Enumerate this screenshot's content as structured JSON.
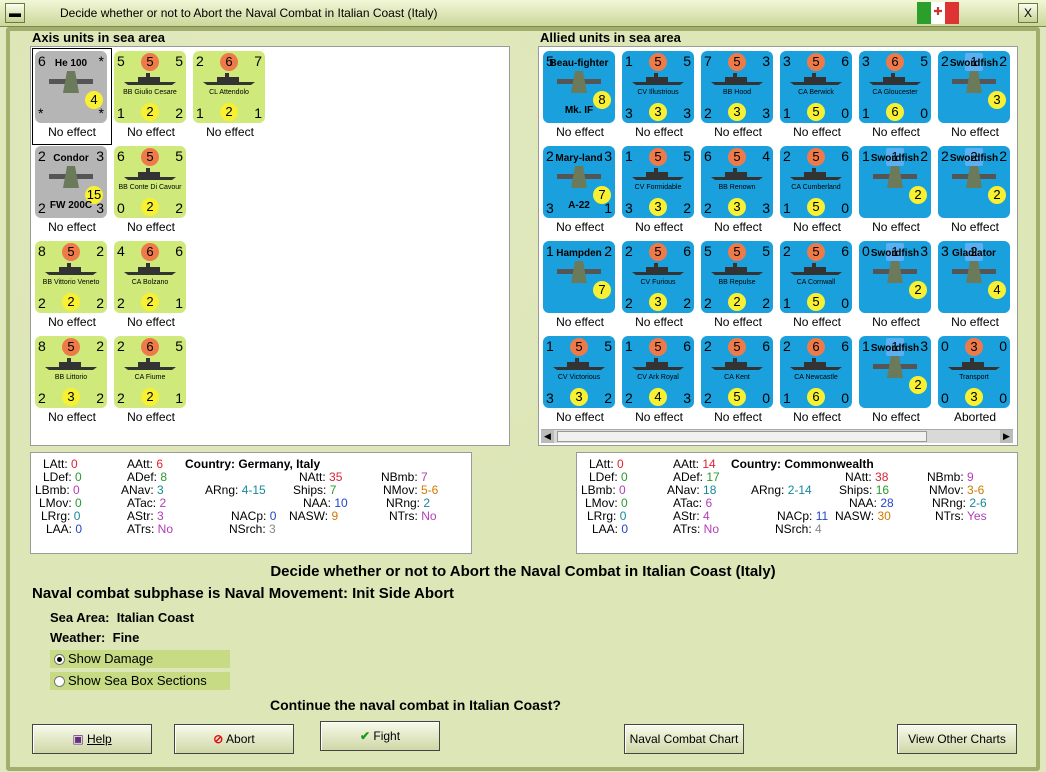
{
  "window": {
    "title": "Decide whether or not to Abort the Naval Combat in Italian Coast (Italy)",
    "min_icon": "minimize-icon",
    "close_label": "X"
  },
  "axis": {
    "header": "Axis units in sea area",
    "units": [
      {
        "name": "He 100",
        "tl": "6",
        "tr": "*",
        "bl": "*",
        "br": "*",
        "mid": "4",
        "status": "No effect",
        "color": "grey",
        "kind": "plane"
      },
      {
        "name": "BB Giulio Cesare",
        "tl": "5",
        "tr": "5",
        "bl": "1",
        "br": "2",
        "mid": "2",
        "top": "5",
        "status": "No effect",
        "color": "green",
        "kind": "ship"
      },
      {
        "name": "CL Attendolo",
        "tl": "2",
        "tr": "7",
        "bl": "1",
        "br": "1",
        "mid": "2",
        "top": "6",
        "status": "No effect",
        "color": "green",
        "kind": "ship"
      },
      {
        "name": "Condor",
        "name2": "FW 200C",
        "tl": "2",
        "tr": "3",
        "bl": "2",
        "br": "3",
        "mid": "15",
        "status": "No effect",
        "color": "grey",
        "kind": "plane"
      },
      {
        "name": "BB Conte Di Cavour",
        "tl": "6",
        "tr": "5",
        "bl": "0",
        "br": "2",
        "mid": "2",
        "top": "5",
        "status": "No effect",
        "color": "green",
        "kind": "ship"
      },
      {
        "name": "BB Vittorio Veneto",
        "tl": "8",
        "tr": "2",
        "bl": "2",
        "br": "2",
        "mid": "2",
        "top": "5",
        "status": "No effect",
        "color": "green",
        "kind": "ship"
      },
      {
        "name": "CA Bolzano",
        "tl": "4",
        "tr": "6",
        "bl": "2",
        "br": "1",
        "mid": "2",
        "top": "6",
        "status": "No effect",
        "color": "green",
        "kind": "ship"
      },
      {
        "name": "BB Littorio",
        "tl": "8",
        "tr": "2",
        "bl": "2",
        "br": "2",
        "mid": "3",
        "top": "5",
        "status": "No effect",
        "color": "green",
        "kind": "ship"
      },
      {
        "name": "CA Fiume",
        "tl": "2",
        "tr": "5",
        "bl": "2",
        "br": "1",
        "mid": "2",
        "top": "6",
        "status": "No effect",
        "color": "green",
        "kind": "ship"
      }
    ],
    "stats": {
      "LAtt": "0",
      "LDef": "0",
      "LBmb": "0",
      "LMov": "0",
      "LRrg": "0",
      "LAA": "0",
      "AAtt": "6",
      "ADef": "8",
      "ANav": "3",
      "ATac": "2",
      "AStr": "3",
      "ATrs": "No",
      "country_label": "Country:",
      "country": "Germany, Italy",
      "ARng": "4-15",
      "NACp": "0",
      "NSrch": "3",
      "NAtt": "35",
      "Ships": "7",
      "NAA": "10",
      "NASW": "9",
      "NBmb": "7",
      "NMov": "5-6",
      "NRng": "2",
      "NTrs": "No"
    }
  },
  "allied": {
    "header": "Allied units in sea area",
    "units": [
      {
        "name": "Beau-fighter",
        "name2": "Mk. IF",
        "tl": "5",
        "mid": "8",
        "status": "No effect",
        "color": "blue",
        "kind": "plane"
      },
      {
        "name": "CV Illustrious",
        "tl": "1",
        "tr": "5",
        "bl": "3",
        "br": "3",
        "mid": "3",
        "top": "5",
        "status": "No effect",
        "color": "blue",
        "kind": "ship"
      },
      {
        "name": "BB Hood",
        "tl": "7",
        "tr": "3",
        "bl": "2",
        "br": "3",
        "mid": "3",
        "top": "5",
        "status": "No effect",
        "color": "blue",
        "kind": "ship"
      },
      {
        "name": "CA Berwick",
        "tl": "3",
        "tr": "6",
        "bl": "1",
        "br": "0",
        "mid": "5",
        "top": "5",
        "status": "No effect",
        "color": "blue",
        "kind": "ship"
      },
      {
        "name": "CA Gloucester",
        "tl": "3",
        "tr": "5",
        "bl": "1",
        "br": "0",
        "mid": "6",
        "top": "6",
        "status": "No effect",
        "color": "blue",
        "kind": "ship"
      },
      {
        "name": "Swordfish",
        "tl": "2",
        "tr": "2",
        "mid": "3",
        "top": "1",
        "status": "No effect",
        "color": "blue",
        "kind": "plane"
      },
      {
        "name": "Mary-land",
        "name2": "A-22",
        "tl": "2",
        "tr": "3",
        "bl": "3",
        "br": "1",
        "mid": "7",
        "status": "No effect",
        "color": "blue",
        "kind": "plane"
      },
      {
        "name": "CV Formidable",
        "tl": "1",
        "tr": "5",
        "bl": "3",
        "br": "2",
        "mid": "3",
        "top": "5",
        "status": "No effect",
        "color": "blue",
        "kind": "ship"
      },
      {
        "name": "BB Renown",
        "tl": "6",
        "tr": "4",
        "bl": "2",
        "br": "3",
        "mid": "3",
        "top": "5",
        "status": "No effect",
        "color": "blue",
        "kind": "ship"
      },
      {
        "name": "CA Cumberland",
        "tl": "2",
        "tr": "6",
        "bl": "1",
        "br": "0",
        "mid": "5",
        "top": "5",
        "status": "No effect",
        "color": "blue",
        "kind": "ship"
      },
      {
        "name": "Swordfish",
        "tl": "1",
        "tr": "2",
        "mid": "2",
        "top": "1",
        "status": "No effect",
        "color": "blue",
        "kind": "plane"
      },
      {
        "name": "Swordfish",
        "tl": "2",
        "tr": "2",
        "mid": "2",
        "top": "2",
        "status": "No effect",
        "color": "blue",
        "kind": "plane"
      },
      {
        "name": "Hampden",
        "tl": "1",
        "tr": "2",
        "mid": "7",
        "status": "No effect",
        "color": "blue",
        "kind": "plane"
      },
      {
        "name": "CV Furious",
        "tl": "2",
        "tr": "6",
        "bl": "2",
        "br": "2",
        "mid": "3",
        "top": "5",
        "status": "No effect",
        "color": "blue",
        "kind": "ship"
      },
      {
        "name": "BB Repulse",
        "tl": "5",
        "tr": "5",
        "bl": "2",
        "br": "2",
        "mid": "2",
        "top": "5",
        "status": "No effect",
        "color": "blue",
        "kind": "ship"
      },
      {
        "name": "CA Cornwall",
        "tl": "2",
        "tr": "6",
        "bl": "1",
        "br": "0",
        "mid": "5",
        "top": "5",
        "status": "No effect",
        "color": "blue",
        "kind": "ship"
      },
      {
        "name": "Swordfish",
        "tl": "0",
        "tr": "3",
        "mid": "2",
        "top": "1",
        "status": "No effect",
        "color": "blue",
        "kind": "plane"
      },
      {
        "name": "Gladiator",
        "tl": "3",
        "mid": "4",
        "top": "2",
        "status": "No effect",
        "color": "blue",
        "kind": "plane"
      },
      {
        "name": "CV Victorious",
        "tl": "1",
        "tr": "5",
        "bl": "3",
        "br": "2",
        "mid": "3",
        "top": "5",
        "status": "No effect",
        "color": "blue",
        "kind": "ship"
      },
      {
        "name": "CV Ark Royal",
        "tl": "1",
        "tr": "6",
        "bl": "2",
        "br": "3",
        "mid": "4",
        "top": "5",
        "status": "No effect",
        "color": "blue",
        "kind": "ship"
      },
      {
        "name": "CA Kent",
        "tl": "2",
        "tr": "6",
        "bl": "2",
        "br": "0",
        "mid": "5",
        "top": "5",
        "status": "No effect",
        "color": "blue",
        "kind": "ship"
      },
      {
        "name": "CA Newcastle",
        "tl": "2",
        "tr": "6",
        "bl": "1",
        "br": "0",
        "mid": "6",
        "top": "6",
        "status": "No effect",
        "color": "blue",
        "kind": "ship"
      },
      {
        "name": "Swordfish",
        "tl": "1",
        "tr": "3",
        "mid": "2",
        "top": "1",
        "status": "No effect",
        "color": "blue",
        "kind": "plane"
      },
      {
        "name": "Transport",
        "tl": "0",
        "tr": "0",
        "bl": "0",
        "br": "0",
        "mid": "3",
        "top": "3",
        "status": "Aborted",
        "color": "blue",
        "kind": "ship"
      }
    ],
    "stats": {
      "LAtt": "0",
      "LDef": "0",
      "LBmb": "0",
      "LMov": "0",
      "LRrg": "0",
      "LAA": "0",
      "AAtt": "14",
      "ADef": "17",
      "ANav": "18",
      "ATac": "6",
      "AStr": "4",
      "ATrs": "No",
      "country_label": "Country:",
      "country": "Commonwealth",
      "ARng": "2-14",
      "NACp": "11",
      "NSrch": "4",
      "NAtt": "38",
      "Ships": "16",
      "NAA": "28",
      "NASW": "30",
      "NBmb": "9",
      "NMov": "3-6",
      "NRng": "2-6",
      "NTrs": "Yes"
    }
  },
  "main": {
    "question_title": "Decide whether or not to Abort the Naval Combat in Italian Coast (Italy)",
    "subphase": "Naval combat subphase is Naval Movement: Init Side Abort",
    "sea_area_label": "Sea Area:",
    "sea_area": "Italian Coast",
    "weather_label": "Weather:",
    "weather": "Fine",
    "radio_damage": "Show Damage",
    "radio_sections": "Show Sea Box Sections",
    "continue_q": "Continue the naval combat in Italian Coast?"
  },
  "buttons": {
    "help": "Help",
    "abort": "Abort",
    "fight": "Fight",
    "chart": "Naval Combat Chart",
    "other": "View Other Charts"
  },
  "colors": {
    "green_counter": "#cfe97a",
    "blue_counter": "#1aa0dc",
    "grey_counter": "#b5b5b5"
  }
}
